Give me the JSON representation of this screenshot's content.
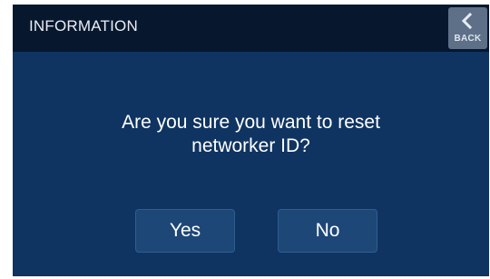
{
  "header": {
    "title": "INFORMATION",
    "back_label": "BACK",
    "back_icon": "chevron-left-icon"
  },
  "dialog": {
    "message_line1": "Are you sure you want to reset",
    "message_line2": "networker ID?",
    "yes_label": "Yes",
    "no_label": "No"
  },
  "colors": {
    "background": "#0f3461",
    "header": "#07172e",
    "button": "#1d4777",
    "back_button": "#5e6f88",
    "text": "#ffffff"
  }
}
